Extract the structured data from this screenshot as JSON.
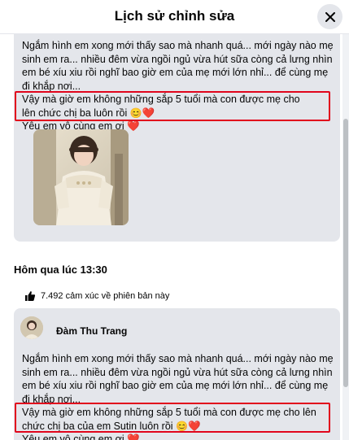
{
  "dialog": {
    "title": "Lịch sử chỉnh sửa",
    "close_icon": "close-icon"
  },
  "version_current": {
    "text_before": "Ngắm hình em xong mới thấy sao mà nhanh quá...  mới ngày nào mẹ sinh em ra... nhiều đêm vừa ngồi ngủ vừa hút sữa còng cả lưng nhìn em bé xíu xiu rồi nghĩ bao giờ em của mẹ mới lớn nhỉ... để cùng mẹ đi khắp nơi...",
    "text_highlight": "Vậy mà giờ em không những sắp 5 tuổi mà con được mẹ cho lên chức chị ba luôn rồi",
    "text_after": "Yêu em vô cùng em ơi"
  },
  "version_previous": {
    "timestamp": "Hôm qua lúc 13:30",
    "reactions_text": "7.492 cảm xúc về phiên bản này",
    "author_name": "Đàm Thu Trang",
    "text_before": "Ngắm hình em xong mới thấy sao mà nhanh quá...  mới ngày nào mẹ sinh em ra... nhiều đêm vừa ngồi ngủ vừa hút sữa còng cả lưng nhìn em bé xíu xiu rồi nghĩ bao giờ em của mẹ mới lớn nhỉ... để cùng mẹ đi khắp nơi...",
    "text_highlight": "Vậy mà giờ em không những sắp 5 tuổi mà con được mẹ cho lên chức chị ba của em Sutin luôn rồi",
    "text_after": "Yêu em vô cùng em ơi"
  },
  "emoji": {
    "smile": "😊",
    "heart": "❤️"
  },
  "colors": {
    "highlight_border": "#e1051c",
    "card_bg": "#e4e6eb",
    "like_blue": "#1877f2"
  }
}
